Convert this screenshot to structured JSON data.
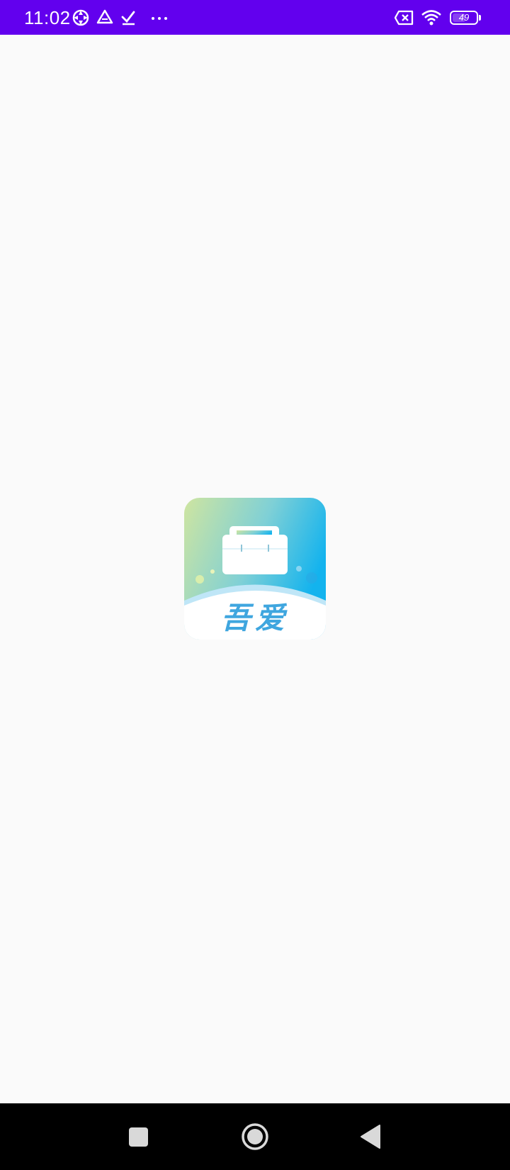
{
  "status_bar": {
    "time": "11:02",
    "battery_level": "49",
    "background_color": "#6200ee",
    "left_icons": [
      "sync-icon",
      "drive-icon",
      "checkmark-icon",
      "more-dots-icon"
    ],
    "right_icons": [
      "no-sim-icon",
      "wifi-icon",
      "battery-icon"
    ]
  },
  "splash": {
    "app_icon_text": "吾爱",
    "icon_name": "toolbox-icon",
    "background_color": "#fafafa"
  },
  "nav_bar": {
    "buttons": [
      "recents-button",
      "home-button",
      "back-button"
    ]
  }
}
